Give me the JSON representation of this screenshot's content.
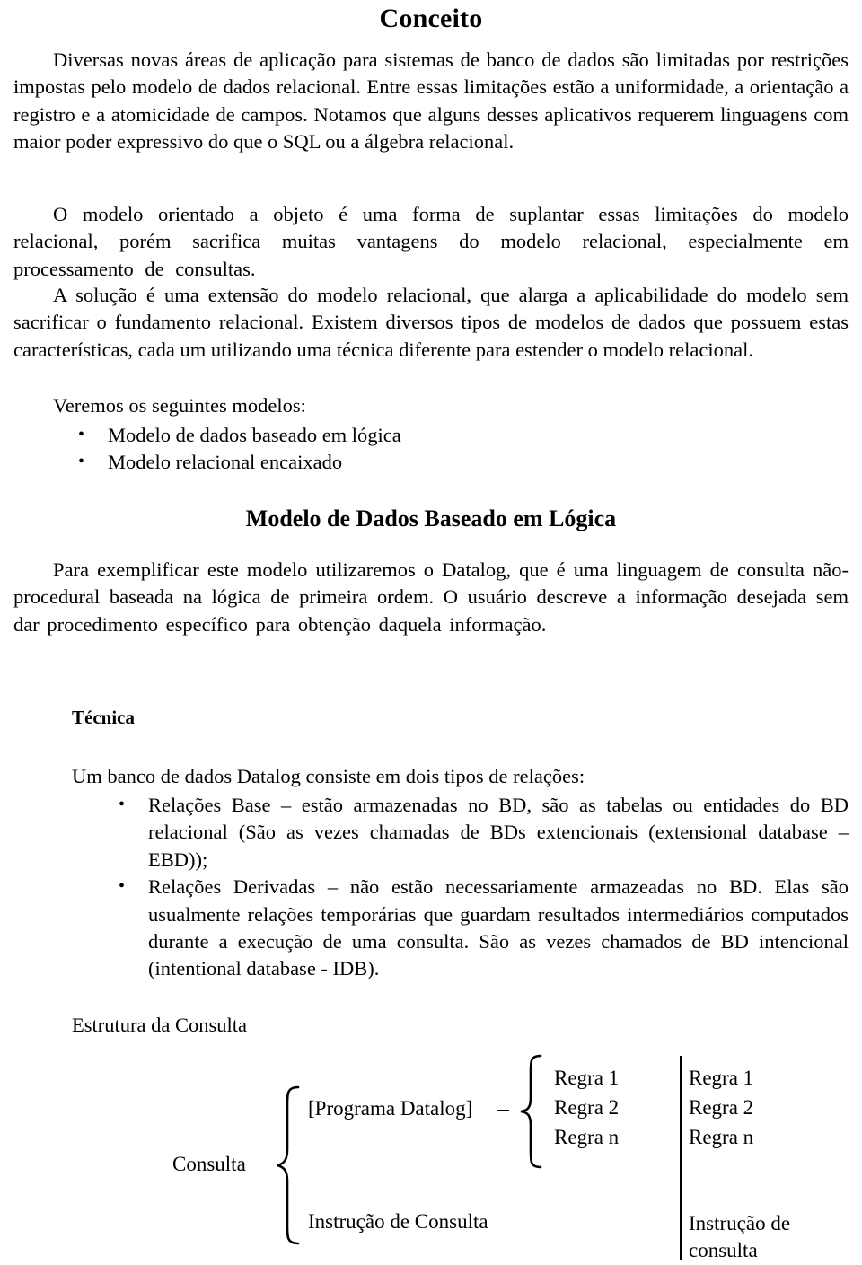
{
  "document": {
    "title": "Conceito",
    "paragraphs": [
      "Diversas novas áreas de aplicação para sistemas de banco de dados são limitadas por restrições impostas pelo modelo de dados relacional. Entre essas limitações estão a uniformidade, a orientação a registro e a atomicidade de campos. Notamos que alguns desses aplicativos requerem linguagens com maior poder expressivo do que o SQL ou a álgebra relacional.",
      "O modelo orientado a objeto é uma forma de suplantar essas limitações do modelo relacional, porém sacrifica muitas vantagens do modelo relacional, especialmente em processamento de consultas.",
      "A solução é uma extensão do modelo relacional, que alarga a aplicabilidade do modelo sem sacrificar o fundamento relacional. Existem diversos tipos de modelos de dados que possuem estas características, cada um utilizando uma técnica diferente para estender o modelo relacional.",
      "Veremos os seguintes modelos:"
    ],
    "models_list": [
      "Modelo de dados baseado em lógica",
      "Modelo relacional encaixado"
    ],
    "section_heading": "Modelo de Dados Baseado em Lógica",
    "section_paragraph": "Para exemplificar este modelo utilizaremos o Datalog, que é uma linguagem de consulta não-procedural baseada na lógica de primeira ordem. O usuário descreve a informação desejada sem dar  procedimento específico para obtenção daquela informação.",
    "technique_heading": "Técnica",
    "technique_intro": "Um banco de dados Datalog consiste em dois tipos de relações:",
    "relations_list": [
      "Relações Base – estão armazenadas no BD, são as tabelas ou entidades do BD relacional (São as vezes chamadas de BDs extencionais (extensional database – EBD));",
      "Relações Derivadas – não estão necessariamente armazeadas no BD. Elas são usualmente relações temporárias que guardam resultados intermediários computados durante a execução de uma consulta. São as vezes chamados de BD intencional (intentional database - IDB)."
    ],
    "diagram_caption": "Estrutura da Consulta"
  },
  "diagram": {
    "root_label": "Consulta",
    "program_label": "[Programa Datalog]",
    "query_statement_label": "Instrução de Consulta",
    "rules": [
      "Regra 1",
      "Regra 2",
      "Regra n"
    ],
    "right_column_rules": [
      "Regra 1",
      "Regra 2",
      "Regra n"
    ],
    "right_column_statement_line1": "Instrução de",
    "right_column_statement_line2": "consulta"
  },
  "colors": {
    "ink": "#000000",
    "paper": "#ffffff"
  }
}
